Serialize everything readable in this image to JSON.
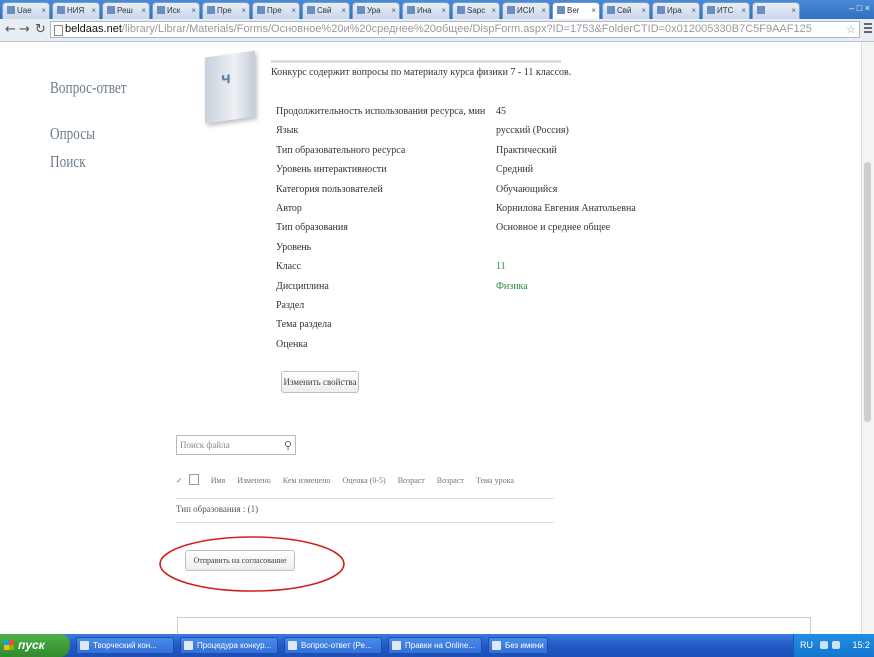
{
  "browser": {
    "tabs": [
      {
        "label": "Uae"
      },
      {
        "label": "НИЯ"
      },
      {
        "label": "Реш"
      },
      {
        "label": "Иск"
      },
      {
        "label": "Пре"
      },
      {
        "label": "Пре"
      },
      {
        "label": "Свй"
      },
      {
        "label": "Ура"
      },
      {
        "label": "Ина"
      },
      {
        "label": "Sapc"
      },
      {
        "label": "ИСИ"
      },
      {
        "label": "Ber"
      },
      {
        "label": "Свй"
      },
      {
        "label": "Ира"
      },
      {
        "label": "ИТС"
      },
      {
        "label": ""
      }
    ],
    "active_tab_index": 11,
    "window_controls": "– □ ×",
    "url_host": "beldaas.net",
    "url_path": "/library/Librar/Materials/Forms/Основное%20и%20среднее%20общее/DispForm.aspx?ID=1753&FolderCTID=0x012005330B7C5F9AAF125"
  },
  "sidebar": {
    "items": [
      {
        "label": "Вопрос-ответ"
      },
      {
        "label": "Опросы"
      },
      {
        "label": "Поиск"
      }
    ]
  },
  "doc": {
    "icon_glyph": "Ч",
    "description": "Конкурс содержит вопросы по материалу курса физики 7 - 11 классов.",
    "properties": [
      {
        "name": "Продолжительность использования ресурса, мин",
        "value": "45",
        "link": false
      },
      {
        "name": "Язык",
        "value": "русский (Россия)",
        "link": false
      },
      {
        "name": "Тип образовательного ресурса",
        "value": "Практический",
        "link": false
      },
      {
        "name": "Уровень интерактивности",
        "value": "Средний",
        "link": false
      },
      {
        "name": "Категория пользователей",
        "value": "Обучающийся",
        "link": false
      },
      {
        "name": "Автор",
        "value": "Корнилова Евгения Анатольевна",
        "link": false
      },
      {
        "name": "Тип образования",
        "value": "Основное и среднее общее",
        "link": false
      },
      {
        "name": "Уровень",
        "value": "",
        "link": false
      },
      {
        "name": "Класс",
        "value": "11",
        "link": true
      },
      {
        "name": "Дисциплина",
        "value": "Физика",
        "link": true
      },
      {
        "name": "Раздел",
        "value": "",
        "link": false
      },
      {
        "name": "Тема раздела",
        "value": "",
        "link": false
      },
      {
        "name": "Оценка",
        "value": "",
        "link": false
      }
    ],
    "view_button": "Изменить свойства"
  },
  "files": {
    "search_placeholder": "Поиск файла",
    "columns": [
      "Имя",
      "Изменено",
      "Кем изменено",
      "Оценка (0-5)",
      "Возраст",
      "Возраст",
      "Тема урока"
    ],
    "group_row": "Тип образования : (1)",
    "send_button": "Отправить на согласование"
  },
  "taskbar": {
    "start_label": "пуск",
    "tasks": [
      {
        "label": "Творческий кон..."
      },
      {
        "label": "Процедура конкур..."
      },
      {
        "label": "Вопрос-ответ (Ре..."
      },
      {
        "label": "Правки на Online..."
      },
      {
        "label": "Без имени"
      }
    ],
    "language": "RU",
    "clock": "15:2"
  },
  "colors": {
    "annotation_red": "#d0201e",
    "link_green": "#2d8f3c",
    "taskbar_blue": "#2458c4"
  }
}
